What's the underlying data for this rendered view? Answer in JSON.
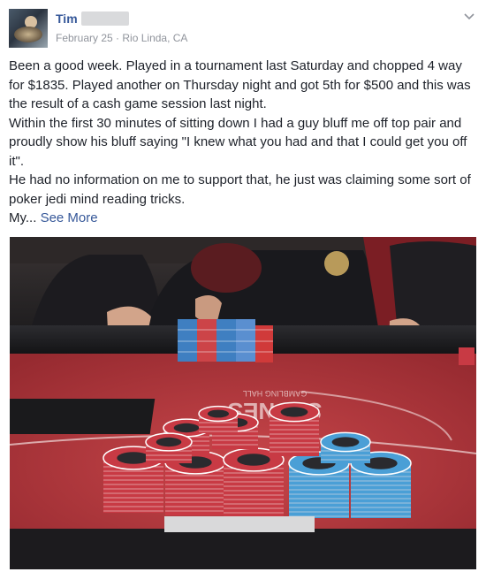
{
  "post": {
    "author": "Tim",
    "date": "February 25",
    "separator": "·",
    "location": "Rio Linda, CA",
    "paragraphs": [
      "Been a good week. Played in a tournament last Saturday and chopped 4 way for $1835. Played another on Thursday night and got 5th for $500 and this was the result of a cash game session last night.",
      "Within the first 30 minutes of sitting down I had a guy bluff me off top pair and proudly show his bluff saying \"I knew what you had and that I could get you off it\".",
      "He had no information on me to support that, he just was claiming some sort of poker jedi mind reading tricks."
    ],
    "truncated_text": "My...",
    "see_more_label": "See More",
    "photo": {
      "table_logo_text": "STONES",
      "table_logo_subtext": "GAMBLING HALL"
    }
  },
  "colors": {
    "link": "#365899",
    "text": "#1d2129",
    "meta": "#90949c",
    "felt": "#b8343a",
    "blue_chip": "#4a9fd6",
    "red_chip": "#c83a44"
  },
  "icons": {
    "menu": "chevron-down-icon",
    "avatar": "profile-photo"
  }
}
